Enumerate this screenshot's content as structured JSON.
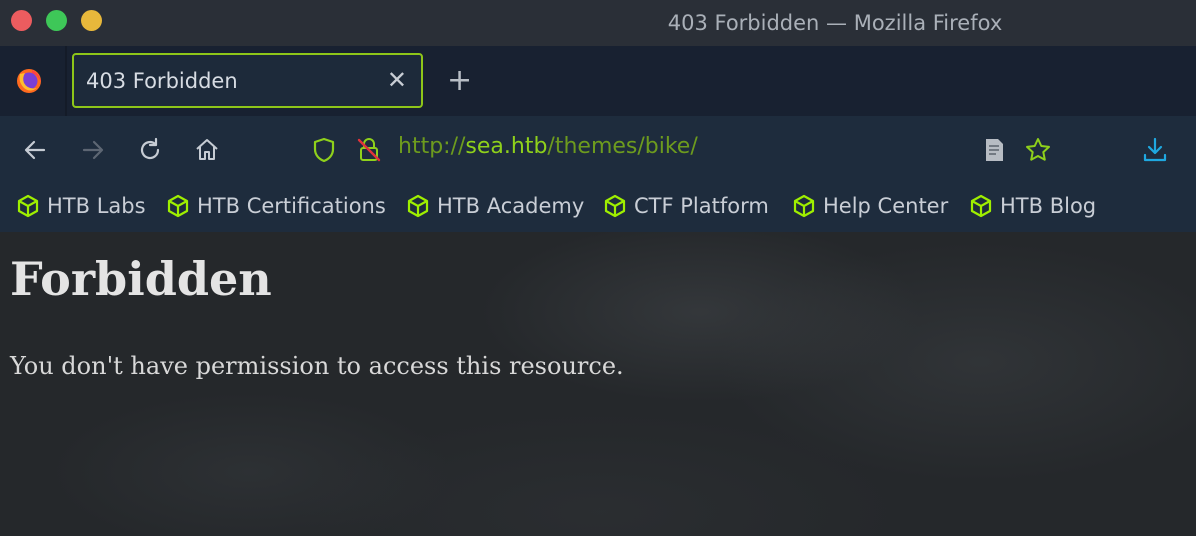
{
  "window": {
    "title": "403 Forbidden — Mozilla Firefox",
    "controls": [
      "close",
      "maximize",
      "minimize"
    ]
  },
  "tabs": [
    {
      "title": "403 Forbidden",
      "active": true,
      "close_glyph": "✕"
    }
  ],
  "new_tab_glyph": "+",
  "navbar": {
    "url": {
      "prefix": "http://",
      "host": "sea.htb",
      "path": "/themes/bike/"
    },
    "icons": [
      "back-icon",
      "forward-icon",
      "reload-icon",
      "home-icon",
      "shield-icon",
      "insecure-lock-icon",
      "reader-mode-icon",
      "bookmark-star-icon",
      "downloads-icon"
    ]
  },
  "bookmarks": [
    {
      "label": "HTB Labs"
    },
    {
      "label": "HTB Certifications"
    },
    {
      "label": "HTB Academy"
    },
    {
      "label": "CTF Platform"
    },
    {
      "label": "Help Center"
    },
    {
      "label": "HTB Blog"
    }
  ],
  "page": {
    "heading": "Forbidden",
    "message": "You don't have permission to access this resource."
  },
  "colors": {
    "accent": "#9fef00",
    "tab_border": "#8ec619",
    "close": "#ec5c5f",
    "maximize": "#3ec758",
    "minimize": "#e8b83b",
    "url_host": "#8fd11b",
    "url_path": "#6d9b1e"
  }
}
